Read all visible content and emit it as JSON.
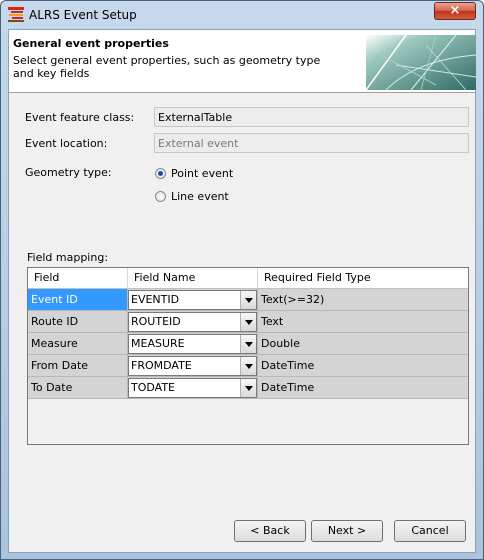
{
  "window": {
    "title": "ALRS Event Setup",
    "close_symbol": "×"
  },
  "banner": {
    "title": "General event properties",
    "subtitle": "Select general event properties, such as geometry type and key fields"
  },
  "form": {
    "feature_class_label": "Event feature class:",
    "feature_class_value": "ExternalTable",
    "location_label": "Event location:",
    "location_value": "External event",
    "geometry_label": "Geometry type:",
    "geometry_options": [
      {
        "label": "Point event",
        "selected": true
      },
      {
        "label": "Line event",
        "selected": false
      }
    ],
    "field_mapping_label": "Field mapping:"
  },
  "grid": {
    "columns": [
      "Field",
      "Field Name",
      "Required Field Type"
    ],
    "rows": [
      {
        "field": "Event ID",
        "field_name": "EVENTID",
        "type": "Text(>=32)",
        "selected": true
      },
      {
        "field": "Route ID",
        "field_name": "ROUTEID",
        "type": "Text",
        "selected": false
      },
      {
        "field": "Measure",
        "field_name": "MEASURE",
        "type": "Double",
        "selected": false
      },
      {
        "field": "From Date",
        "field_name": "FROMDATE",
        "type": "DateTime",
        "selected": false
      },
      {
        "field": "To Date",
        "field_name": "TODATE",
        "type": "DateTime",
        "selected": false
      }
    ]
  },
  "buttons": {
    "back": "< Back",
    "next": "Next >",
    "cancel": "Cancel"
  },
  "icons": {
    "app": "alrs-app-icon",
    "close": "close-icon",
    "banner": "map-banner-image",
    "dropdown": "chevron-down-icon"
  },
  "colors": {
    "selection": "#3399ff",
    "radio_dot": "#1d4f9c",
    "close_button": "#c0321a"
  }
}
